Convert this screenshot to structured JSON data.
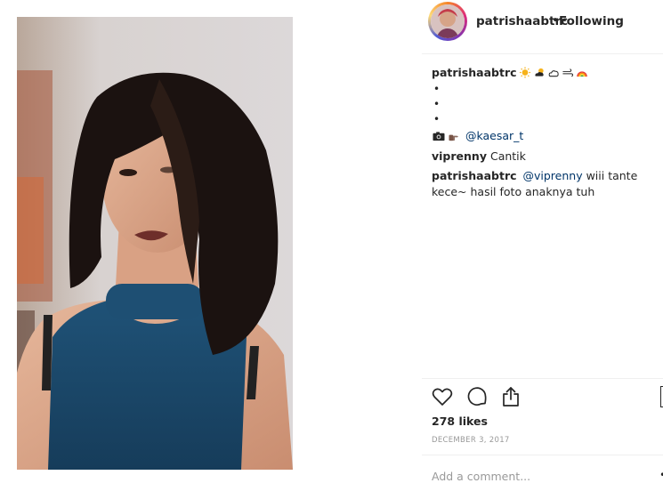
{
  "post": {
    "photo_alt": "Portrait photo",
    "header": {
      "username": "patrishaabtrc",
      "separator": "•",
      "follow_status": "Following"
    },
    "caption": {
      "username": "patrishaabtrc",
      "emojis": [
        "sun-icon",
        "sun-behind-cloud-icon",
        "cloud-icon",
        "wind-icon",
        "rainbow-icon"
      ],
      "bullets": [
        "•",
        "•",
        "•"
      ],
      "credit_icons": [
        "camera-icon",
        "pointing-hand-icon"
      ],
      "credit_mention": "@kaesar_t"
    },
    "comments": [
      {
        "username": "viprenny",
        "text": "Cantik",
        "mention": ""
      },
      {
        "username": "patrishaabtrc",
        "mention": "@viprenny",
        "text": " wiii tante kece~ hasil foto anaknya tuh"
      }
    ],
    "actions": {
      "like_icon": "heart-icon",
      "comment_icon": "comment-icon",
      "share_icon": "share-icon",
      "save_icon": "bookmark-icon"
    },
    "likes": "278 likes",
    "date": "DECEMBER 3, 2017",
    "add_comment_placeholder": "Add a comment...",
    "more": "•"
  },
  "colors": {
    "text": "#262626",
    "mention": "#003569",
    "muted": "#999999",
    "divider": "#efefef",
    "sweater": "#1c4a6e"
  }
}
